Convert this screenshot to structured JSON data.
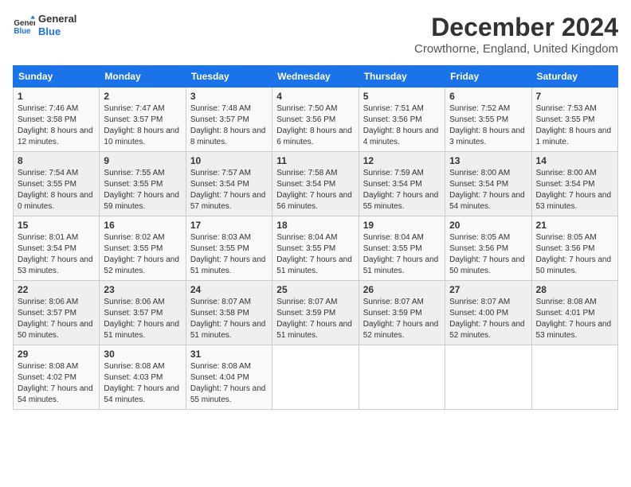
{
  "logo": {
    "line1": "General",
    "line2": "Blue",
    "icon_color": "#1a73e8"
  },
  "header": {
    "title": "December 2024",
    "subtitle": "Crowthorne, England, United Kingdom"
  },
  "columns": [
    "Sunday",
    "Monday",
    "Tuesday",
    "Wednesday",
    "Thursday",
    "Friday",
    "Saturday"
  ],
  "weeks": [
    [
      {
        "day": "1",
        "sunrise": "7:46 AM",
        "sunset": "3:58 PM",
        "daylight": "8 hours and 12 minutes."
      },
      {
        "day": "2",
        "sunrise": "7:47 AM",
        "sunset": "3:57 PM",
        "daylight": "8 hours and 10 minutes."
      },
      {
        "day": "3",
        "sunrise": "7:48 AM",
        "sunset": "3:57 PM",
        "daylight": "8 hours and 8 minutes."
      },
      {
        "day": "4",
        "sunrise": "7:50 AM",
        "sunset": "3:56 PM",
        "daylight": "8 hours and 6 minutes."
      },
      {
        "day": "5",
        "sunrise": "7:51 AM",
        "sunset": "3:56 PM",
        "daylight": "8 hours and 4 minutes."
      },
      {
        "day": "6",
        "sunrise": "7:52 AM",
        "sunset": "3:55 PM",
        "daylight": "8 hours and 3 minutes."
      },
      {
        "day": "7",
        "sunrise": "7:53 AM",
        "sunset": "3:55 PM",
        "daylight": "8 hours and 1 minute."
      }
    ],
    [
      {
        "day": "8",
        "sunrise": "7:54 AM",
        "sunset": "3:55 PM",
        "daylight": "8 hours and 0 minutes."
      },
      {
        "day": "9",
        "sunrise": "7:55 AM",
        "sunset": "3:55 PM",
        "daylight": "7 hours and 59 minutes."
      },
      {
        "day": "10",
        "sunrise": "7:57 AM",
        "sunset": "3:54 PM",
        "daylight": "7 hours and 57 minutes."
      },
      {
        "day": "11",
        "sunrise": "7:58 AM",
        "sunset": "3:54 PM",
        "daylight": "7 hours and 56 minutes."
      },
      {
        "day": "12",
        "sunrise": "7:59 AM",
        "sunset": "3:54 PM",
        "daylight": "7 hours and 55 minutes."
      },
      {
        "day": "13",
        "sunrise": "8:00 AM",
        "sunset": "3:54 PM",
        "daylight": "7 hours and 54 minutes."
      },
      {
        "day": "14",
        "sunrise": "8:00 AM",
        "sunset": "3:54 PM",
        "daylight": "7 hours and 53 minutes."
      }
    ],
    [
      {
        "day": "15",
        "sunrise": "8:01 AM",
        "sunset": "3:54 PM",
        "daylight": "7 hours and 53 minutes."
      },
      {
        "day": "16",
        "sunrise": "8:02 AM",
        "sunset": "3:55 PM",
        "daylight": "7 hours and 52 minutes."
      },
      {
        "day": "17",
        "sunrise": "8:03 AM",
        "sunset": "3:55 PM",
        "daylight": "7 hours and 51 minutes."
      },
      {
        "day": "18",
        "sunrise": "8:04 AM",
        "sunset": "3:55 PM",
        "daylight": "7 hours and 51 minutes."
      },
      {
        "day": "19",
        "sunrise": "8:04 AM",
        "sunset": "3:55 PM",
        "daylight": "7 hours and 51 minutes."
      },
      {
        "day": "20",
        "sunrise": "8:05 AM",
        "sunset": "3:56 PM",
        "daylight": "7 hours and 50 minutes."
      },
      {
        "day": "21",
        "sunrise": "8:05 AM",
        "sunset": "3:56 PM",
        "daylight": "7 hours and 50 minutes."
      }
    ],
    [
      {
        "day": "22",
        "sunrise": "8:06 AM",
        "sunset": "3:57 PM",
        "daylight": "7 hours and 50 minutes."
      },
      {
        "day": "23",
        "sunrise": "8:06 AM",
        "sunset": "3:57 PM",
        "daylight": "7 hours and 51 minutes."
      },
      {
        "day": "24",
        "sunrise": "8:07 AM",
        "sunset": "3:58 PM",
        "daylight": "7 hours and 51 minutes."
      },
      {
        "day": "25",
        "sunrise": "8:07 AM",
        "sunset": "3:59 PM",
        "daylight": "7 hours and 51 minutes."
      },
      {
        "day": "26",
        "sunrise": "8:07 AM",
        "sunset": "3:59 PM",
        "daylight": "7 hours and 52 minutes."
      },
      {
        "day": "27",
        "sunrise": "8:07 AM",
        "sunset": "4:00 PM",
        "daylight": "7 hours and 52 minutes."
      },
      {
        "day": "28",
        "sunrise": "8:08 AM",
        "sunset": "4:01 PM",
        "daylight": "7 hours and 53 minutes."
      }
    ],
    [
      {
        "day": "29",
        "sunrise": "8:08 AM",
        "sunset": "4:02 PM",
        "daylight": "7 hours and 54 minutes."
      },
      {
        "day": "30",
        "sunrise": "8:08 AM",
        "sunset": "4:03 PM",
        "daylight": "7 hours and 54 minutes."
      },
      {
        "day": "31",
        "sunrise": "8:08 AM",
        "sunset": "4:04 PM",
        "daylight": "7 hours and 55 minutes."
      },
      null,
      null,
      null,
      null
    ]
  ],
  "labels": {
    "sunrise": "Sunrise:",
    "sunset": "Sunset:",
    "daylight": "Daylight:"
  }
}
